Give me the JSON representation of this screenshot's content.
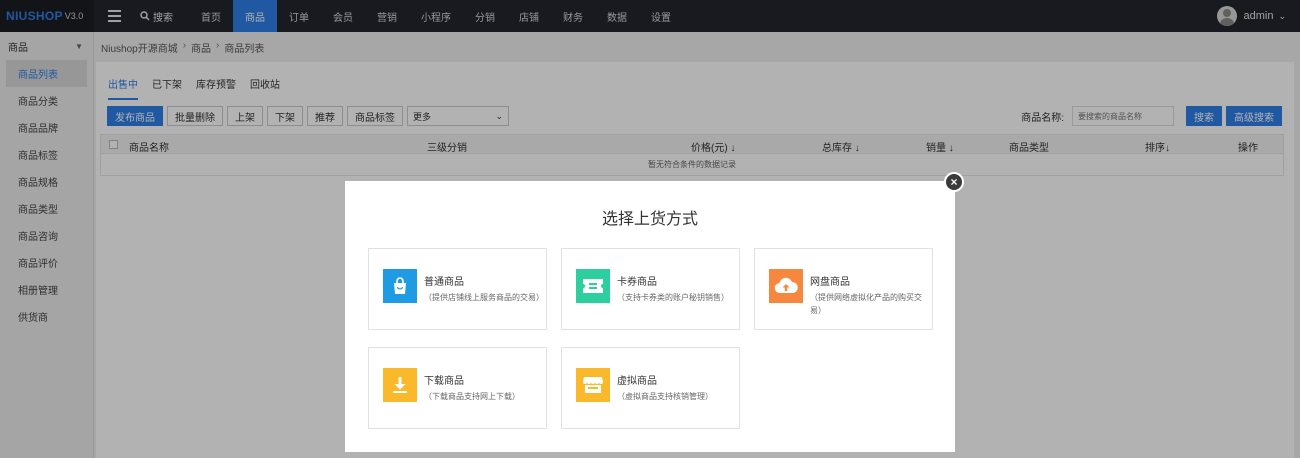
{
  "app": {
    "brand": "NIUSHOP",
    "version": "V3.0",
    "search_label": "搜索",
    "user": "admin"
  },
  "nav": [
    "首页",
    "商品",
    "订单",
    "会员",
    "营销",
    "小程序",
    "分销",
    "店铺",
    "财务",
    "数据",
    "设置"
  ],
  "sidebar": {
    "header": "商品",
    "items": [
      "商品列表",
      "商品分类",
      "商品品牌",
      "商品标签",
      "商品规格",
      "商品类型",
      "商品咨询",
      "商品评价",
      "相册管理",
      "供货商"
    ]
  },
  "breadcrumb": [
    "Niushop开源商城",
    "商品",
    "商品列表"
  ],
  "tabs": [
    "出售中",
    "已下架",
    "库存预警",
    "回收站"
  ],
  "toolbar": {
    "buttons": [
      "发布商品",
      "批量删除",
      "上架",
      "下架",
      "推荐",
      "商品标签"
    ],
    "select_value": "更多"
  },
  "filter": {
    "label": "商品名称:",
    "placeholder": "要搜索的商品名称",
    "search": "搜索",
    "advanced": "高级搜索"
  },
  "table": {
    "columns": [
      "商品名称",
      "三级分销",
      "价格(元) ↓",
      "总库存 ↓",
      "销量 ↓",
      "商品类型",
      "排序↓",
      "操作"
    ],
    "empty_text": "暂无符合条件的数据记录"
  },
  "modal": {
    "title": "选择上货方式",
    "close": "×",
    "options": [
      {
        "name": "普通商品",
        "desc": "（提供店铺线上服务商品的交易）",
        "icon": "shopping-bag-icon",
        "color": "#1f9be3"
      },
      {
        "name": "卡券商品",
        "desc": "（支持卡券类的账户秘钥销售）",
        "icon": "ticket-icon",
        "color": "#2ecf9f"
      },
      {
        "name": "网盘商品",
        "desc": "（提供网络虚拟化产品的购买交易）",
        "icon": "cloud-upload-icon",
        "color": "#f5873f"
      },
      {
        "name": "下载商品",
        "desc": "（下载商品支持网上下载）",
        "icon": "download-icon",
        "color": "#f9b92a"
      },
      {
        "name": "虚拟商品",
        "desc": "（虚拟商品支持核销管理）",
        "icon": "store-icon",
        "color": "#f9b92a"
      }
    ]
  }
}
